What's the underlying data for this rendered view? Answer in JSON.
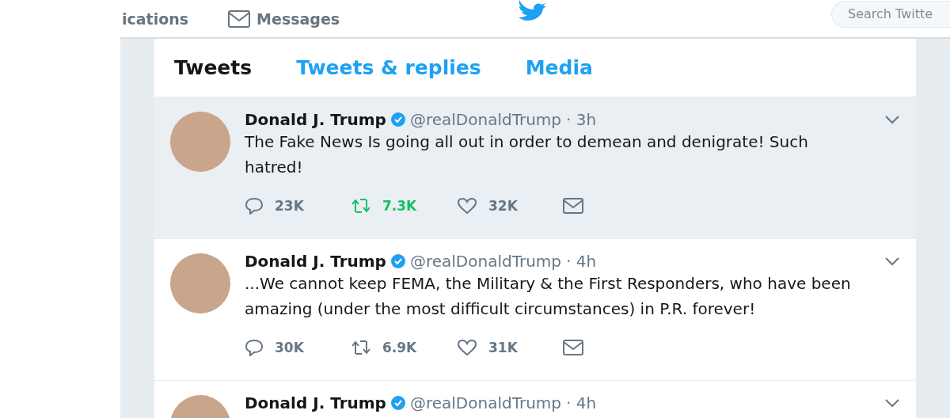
{
  "nav": {
    "items": [
      "ications",
      "Messages"
    ],
    "search": {
      "placeholder": "Search Twitte"
    }
  },
  "tabs": [
    {
      "label": "Tweets",
      "selected": true
    },
    {
      "label": "Tweets & replies",
      "selected": false
    },
    {
      "label": "Media",
      "selected": false
    }
  ],
  "tweets": [
    {
      "name": "Donald J. Trump",
      "handle": "@realDonaldTrump",
      "time": "· 3h",
      "highlighted": true,
      "text": "The Fake News Is going all out in order to demean and denigrate! Such hatred!",
      "replies": "23K",
      "retweets": "7.3K",
      "retweeted": true,
      "likes": "32K"
    },
    {
      "name": "Donald J. Trump",
      "handle": "@realDonaldTrump",
      "time": "· 4h",
      "highlighted": false,
      "text": "...We cannot keep FEMA, the Military & the First Responders, who have been amazing (under the most difficult circumstances) in P.R. forever!",
      "replies": "30K",
      "retweets": "6.9K",
      "retweeted": false,
      "likes": "31K"
    },
    {
      "name": "Donald J. Trump",
      "handle": "@realDonaldTrump",
      "time": "· 4h",
      "highlighted": false
    }
  ]
}
